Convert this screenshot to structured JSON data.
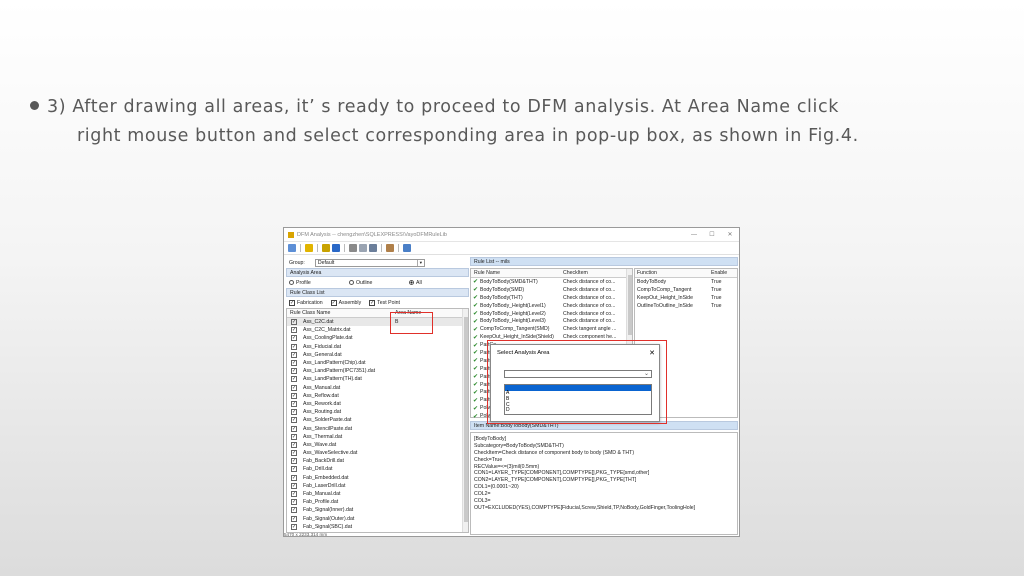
{
  "slide": {
    "line1": "3) After drawing all areas, it’ s ready to proceed to DFM analysis. At Area Name click",
    "line2": "right mouse button and select corresponding area in pop-up box, as shown in Fig.4."
  },
  "window": {
    "title": "DFM Analysis  --  chengzhen\\SQLEXPRESS\\VayoDFMRuleLib",
    "controls": [
      "—",
      "☐",
      "✕"
    ]
  },
  "left_panel": {
    "group_label": "Group:",
    "group_value": "Default",
    "analysis_area_label": "Analysis Area",
    "radios": [
      {
        "label": "Profile",
        "selected": false
      },
      {
        "label": "Outline",
        "selected": false
      },
      {
        "label": "All",
        "selected": true
      }
    ],
    "rule_class_list_label": "Rule Class List",
    "checkboxes": [
      {
        "label": "Fabrication",
        "checked": true
      },
      {
        "label": "Assembly",
        "checked": true
      },
      {
        "label": "Test Point",
        "checked": true
      }
    ],
    "col_rule_class": "Rule Class Name",
    "col_area": "Area Name",
    "rows": [
      {
        "name": "Ass_C2C.dat",
        "area": "B"
      },
      {
        "name": "Ass_C2C_Matrix.dat",
        "area": ""
      },
      {
        "name": "Ass_CoolingPlate.dat",
        "area": ""
      },
      {
        "name": "Ass_Fiducial.dat",
        "area": ""
      },
      {
        "name": "Ass_General.dat",
        "area": ""
      },
      {
        "name": "Ass_LandPattern(Chip).dat",
        "area": ""
      },
      {
        "name": "Ass_LandPattern(IPC7351).dat",
        "area": ""
      },
      {
        "name": "Ass_LandPattern(TH).dat",
        "area": ""
      },
      {
        "name": "Ass_Manual.dat",
        "area": ""
      },
      {
        "name": "Ass_Reflow.dat",
        "area": ""
      },
      {
        "name": "Ass_Rework.dat",
        "area": ""
      },
      {
        "name": "Ass_Routing.dat",
        "area": ""
      },
      {
        "name": "Ass_SolderPaste.dat",
        "area": ""
      },
      {
        "name": "Ass_StencilPaste.dat",
        "area": ""
      },
      {
        "name": "Ass_Thermal.dat",
        "area": ""
      },
      {
        "name": "Ass_Wave.dat",
        "area": ""
      },
      {
        "name": "Ass_WaveSelective.dat",
        "area": ""
      },
      {
        "name": "Fab_BackDrill.dat",
        "area": ""
      },
      {
        "name": "Fab_Drill.dat",
        "area": ""
      },
      {
        "name": "Fab_Embedded.dat",
        "area": ""
      },
      {
        "name": "Fab_LaserDrill.dat",
        "area": ""
      },
      {
        "name": "Fab_Manual.dat",
        "area": ""
      },
      {
        "name": "Fab_Profile.dat",
        "area": ""
      },
      {
        "name": "Fab_Signal(Inner).dat",
        "area": ""
      },
      {
        "name": "Fab_Signal(Outer).dat",
        "area": ""
      },
      {
        "name": "Fab_Signal(SBC).dat",
        "area": ""
      }
    ]
  },
  "rule_list": {
    "header": "Rule List -- mils",
    "col_rule": "Rule Name",
    "col_check": "CheckItem",
    "rows": [
      {
        "name": "BodyToBody(SMD&THT)",
        "check": "Check distance of co..."
      },
      {
        "name": "BodyToBody(SMD)",
        "check": "Check distance of co..."
      },
      {
        "name": "BodyToBody(THT)",
        "check": "Check distance of co..."
      },
      {
        "name": "BodyToBody_Height(Level1)",
        "check": "Check distance of co..."
      },
      {
        "name": "BodyToBody_Height(Level2)",
        "check": "Check distance of co..."
      },
      {
        "name": "BodyToBody_Height(Level3)",
        "check": "Check distance of co..."
      },
      {
        "name": "CompToComp_Tangent(SMD)",
        "check": "Check tangent angle ..."
      },
      {
        "name": "KeepOut_Height_InSide(Shield)",
        "check": "Check component he..."
      },
      {
        "name": "PartCe",
        "check": ""
      },
      {
        "name": "PartCe",
        "check": ""
      },
      {
        "name": "PartCe",
        "check": ""
      },
      {
        "name": "PartCe",
        "check": ""
      },
      {
        "name": "PartCe",
        "check": ""
      },
      {
        "name": "PartCe",
        "check": ""
      },
      {
        "name": "PartCe",
        "check": ""
      },
      {
        "name": "PartCe",
        "check": ""
      },
      {
        "name": "Polver",
        "check": ""
      },
      {
        "name": "Polver",
        "check": ""
      }
    ],
    "col_function": "Function",
    "col_enable": "Enable",
    "functions": [
      {
        "fn": "BodyToBody",
        "en": "True"
      },
      {
        "fn": "CompToComp_Tangent",
        "en": "True"
      },
      {
        "fn": "KeepOut_Height_InSide",
        "en": "True"
      },
      {
        "fn": "OutlineToOutline_InSide",
        "en": "True"
      }
    ]
  },
  "item_panel": {
    "header": "Item Name:BodyToBody(SMD&THT)",
    "lines": [
      "[BodyToBody]",
      "Subcategory=BodyToBody(SMD&THT)",
      "CheckItem=Check distance of component body to body (SMD & THT)",
      "Check=True",
      "RECValue=<=(3)mil(0.5mm)",
      "CON1=LAYER_TYPE[COMPONENT],COMPTYPE[],PKG_TYPE[smd,other]",
      "CON2=LAYER_TYPE[COMPONENT],COMPTYPE[],PKG_TYPE[THT]",
      "COL1=(0.0001~20)",
      "COL2=",
      "COL3=",
      "OUT=EXCLUDED(YES),COMPTYPE[Fiducial,Screw,Shield,TP,NoBody,GoldFinger,ToolingHole]"
    ]
  },
  "dialog": {
    "title": "Select Analysis Area",
    "close": "✕",
    "combo_value": "",
    "options": [
      "",
      "A",
      "B",
      "C",
      "D"
    ],
    "highlighted_index": 0
  },
  "status": "5470 x 2233.314 mm",
  "colors": {
    "accent": "#0a64d0",
    "highlight_box": "#e0302a",
    "ok_check": "#2c8a2c"
  }
}
